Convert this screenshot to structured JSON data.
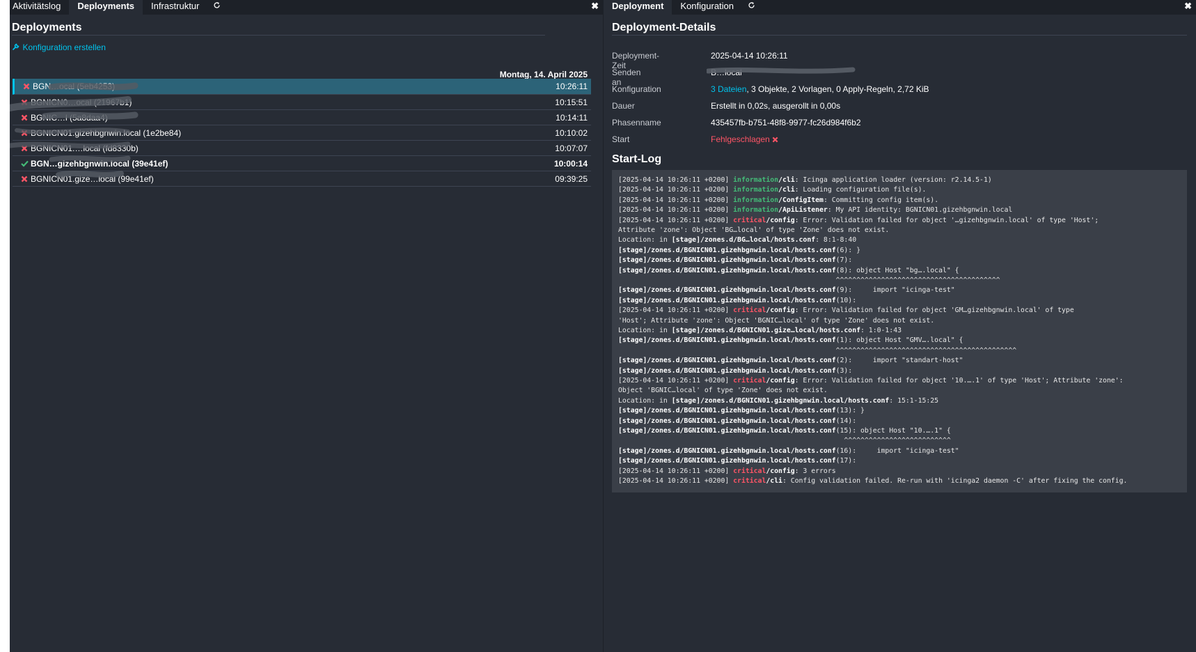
{
  "left_pane": {
    "tabs": [
      {
        "label": "Aktivitätslog",
        "active": false
      },
      {
        "label": "Deployments",
        "active": true
      },
      {
        "label": "Infrastruktur",
        "active": false
      }
    ],
    "refresh_icon": "refresh-icon",
    "close_icon": "close-icon",
    "title": "Deployments",
    "create_config_link": "Konfiguration erstellen",
    "create_config_icon": "wrench-icon",
    "date_header": "Montag, 14. April 2025",
    "deployments": [
      {
        "name": "BGN…ocal (5eb4253)",
        "time": "10:26:11",
        "status": "failed",
        "selected": true
      },
      {
        "name": "BGNICN0…ocal (21967b1)",
        "time": "10:15:51",
        "status": "failed"
      },
      {
        "name": "BGNIC…l (5a8daa4)",
        "time": "10:14:11",
        "status": "failed"
      },
      {
        "name": "BGNICN01.gizehbgnwin.local (1e2be84)",
        "time": "10:10:02",
        "status": "failed"
      },
      {
        "name": "BGNICN01.…local (fd8330b)",
        "time": "10:07:07",
        "status": "failed"
      },
      {
        "name": "BGN…gizehbgnwin.local (39e41ef)",
        "time": "10:00:14",
        "status": "success",
        "bold": true
      },
      {
        "name": "BGNICN01.gize…local (99e41ef)",
        "time": "09:39:25",
        "status": "failed"
      }
    ]
  },
  "right_pane": {
    "tabs": [
      {
        "label": "Deployment",
        "active": true
      },
      {
        "label": "Konfiguration",
        "active": false
      }
    ],
    "refresh_icon": "refresh-icon",
    "close_icon": "close-icon",
    "title": "Deployment-Details",
    "details": {
      "time_label": "Deployment-Zeit",
      "time_value": "2025-04-14 10:26:11",
      "sent_label": "Senden an",
      "sent_value": "B…local",
      "config_label": "Konfiguration",
      "config_files_link": "3 Dateien",
      "config_rest": ", 3 Objekte, 2 Vorlagen, 0 Apply-Regeln, 2,72 KiB",
      "duration_label": "Dauer",
      "duration_value": "Erstellt in 0,02s, ausgerollt in 0,00s",
      "stage_label": "Phasenname",
      "stage_value": "435457fb-b751-48f8-9977-fc26d984f6b2",
      "start_label": "Start",
      "start_value": "Fehlgeschlagen"
    },
    "log_title": "Start-Log",
    "log_lines": [
      {
        "pre": "[2025-04-14 10:26:11 +0200] ",
        "level": "information",
        "cls": "info",
        "fac": "/cli",
        "msg": ": Icinga application loader (version: r2.14.5-1)"
      },
      {
        "pre": "[2025-04-14 10:26:11 +0200] ",
        "level": "information",
        "cls": "info",
        "fac": "/cli",
        "msg": ": Loading configuration file(s)."
      },
      {
        "pre": "[2025-04-14 10:26:11 +0200] ",
        "level": "information",
        "cls": "info",
        "fac": "/ConfigItem",
        "msg": ": Committing config item(s)."
      },
      {
        "pre": "[2025-04-14 10:26:11 +0200] ",
        "level": "information",
        "cls": "info",
        "fac": "/ApiListener",
        "msg": ": My API identity: BGNICN01.gizehbgnwin.local"
      },
      {
        "pre": "[2025-04-14 10:26:11 +0200] ",
        "level": "critical",
        "cls": "crit",
        "fac": "/config",
        "msg": ": Error: Validation failed for object '…gizehbgnwin.local' of type 'Host';"
      },
      {
        "pre": "",
        "level": "",
        "cls": "",
        "fac": "",
        "msg": "Attribute 'zone': Object 'BG…local' of type 'Zone' does not exist."
      },
      {
        "pre": "Location: in ",
        "level": "",
        "cls": "",
        "fac": "[stage]/zones.d/BG…local/hosts.conf",
        "msg": ": 8:1-8:40"
      },
      {
        "pre": "",
        "level": "",
        "cls": "",
        "fac": "[stage]/zones.d/BGNICN01.gizehbgnwin.local/hosts.conf",
        "msg": "(6): }"
      },
      {
        "pre": "",
        "level": "",
        "cls": "",
        "fac": "[stage]/zones.d/BGNICN01.gizehbgnwin.local/hosts.conf",
        "msg": "(7):"
      },
      {
        "pre": "",
        "level": "",
        "cls": "",
        "fac": "[stage]/zones.d/BGNICN01.gizehbgnwin.local/hosts.conf",
        "msg": "(8): object Host \"bg….local\" {"
      },
      {
        "pre": "",
        "level": "",
        "cls": "",
        "fac": "",
        "msg": "                                                     ^^^^^^^^^^^^^^^^^^^^^^^^^^^^^^^^^^^^^^^^"
      },
      {
        "pre": "",
        "level": "",
        "cls": "",
        "fac": "[stage]/zones.d/BGNICN01.gizehbgnwin.local/hosts.conf",
        "msg": "(9):     import \"icinga-test\""
      },
      {
        "pre": "",
        "level": "",
        "cls": "",
        "fac": "[stage]/zones.d/BGNICN01.gizehbgnwin.local/hosts.conf",
        "msg": "(10):"
      },
      {
        "pre": "[2025-04-14 10:26:11 +0200] ",
        "level": "critical",
        "cls": "crit",
        "fac": "/config",
        "msg": ": Error: Validation failed for object 'GM…gizehbgnwin.local' of type"
      },
      {
        "pre": "",
        "level": "",
        "cls": "",
        "fac": "",
        "msg": "'Host'; Attribute 'zone': Object 'BGNIC…local' of type 'Zone' does not exist."
      },
      {
        "pre": "Location: in ",
        "level": "",
        "cls": "",
        "fac": "[stage]/zones.d/BGNICN01.gize…local/hosts.conf",
        "msg": ": 1:0-1:43"
      },
      {
        "pre": "",
        "level": "",
        "cls": "",
        "fac": "[stage]/zones.d/BGNICN01.gizehbgnwin.local/hosts.conf",
        "msg": "(1): object Host \"GMV….local\" {"
      },
      {
        "pre": "",
        "level": "",
        "cls": "",
        "fac": "",
        "msg": "                                                     ^^^^^^^^^^^^^^^^^^^^^^^^^^^^^^^^^^^^^^^^^^^^"
      },
      {
        "pre": "",
        "level": "",
        "cls": "",
        "fac": "[stage]/zones.d/BGNICN01.gizehbgnwin.local/hosts.conf",
        "msg": "(2):     import \"standart-host\""
      },
      {
        "pre": "",
        "level": "",
        "cls": "",
        "fac": "[stage]/zones.d/BGNICN01.gizehbgnwin.local/hosts.conf",
        "msg": "(3):"
      },
      {
        "pre": "[2025-04-14 10:26:11 +0200] ",
        "level": "critical",
        "cls": "crit",
        "fac": "/config",
        "msg": ": Error: Validation failed for object '10.….1' of type 'Host'; Attribute 'zone':"
      },
      {
        "pre": "",
        "level": "",
        "cls": "",
        "fac": "",
        "msg": "Object 'BGNIC…local' of type 'Zone' does not exist."
      },
      {
        "pre": "Location: in ",
        "level": "",
        "cls": "",
        "fac": "[stage]/zones.d/BGNICN01.gizehbgnwin.local/hosts.conf",
        "msg": ": 15:1-15:25"
      },
      {
        "pre": "",
        "level": "",
        "cls": "",
        "fac": "[stage]/zones.d/BGNICN01.gizehbgnwin.local/hosts.conf",
        "msg": "(13): }"
      },
      {
        "pre": "",
        "level": "",
        "cls": "",
        "fac": "[stage]/zones.d/BGNICN01.gizehbgnwin.local/hosts.conf",
        "msg": "(14):"
      },
      {
        "pre": "",
        "level": "",
        "cls": "",
        "fac": "[stage]/zones.d/BGNICN01.gizehbgnwin.local/hosts.conf",
        "msg": "(15): object Host \"10.….1\" {"
      },
      {
        "pre": "",
        "level": "",
        "cls": "",
        "fac": "",
        "msg": "                                                       ^^^^^^^^^^^^^^^^^^^^^^^^^^"
      },
      {
        "pre": "",
        "level": "",
        "cls": "",
        "fac": "[stage]/zones.d/BGNICN01.gizehbgnwin.local/hosts.conf",
        "msg": "(16):     import \"icinga-test\""
      },
      {
        "pre": "",
        "level": "",
        "cls": "",
        "fac": "[stage]/zones.d/BGNICN01.gizehbgnwin.local/hosts.conf",
        "msg": "(17):"
      },
      {
        "pre": "[2025-04-14 10:26:11 +0200] ",
        "level": "critical",
        "cls": "crit",
        "fac": "/config",
        "msg": ": 3 errors"
      },
      {
        "pre": "[2025-04-14 10:26:11 +0200] ",
        "level": "critical",
        "cls": "crit",
        "fac": "/cli",
        "msg": ": Config validation failed. Re-run with 'icinga2 daemon -C' after fixing the config."
      }
    ]
  },
  "colors": {
    "background": "#272c35",
    "tabbar": "#1d2128",
    "accent": "#00c3ed",
    "selected_row": "#2c6378",
    "failed": "#ff5566",
    "success": "#44bb77",
    "log_background": "#3a3f48"
  }
}
